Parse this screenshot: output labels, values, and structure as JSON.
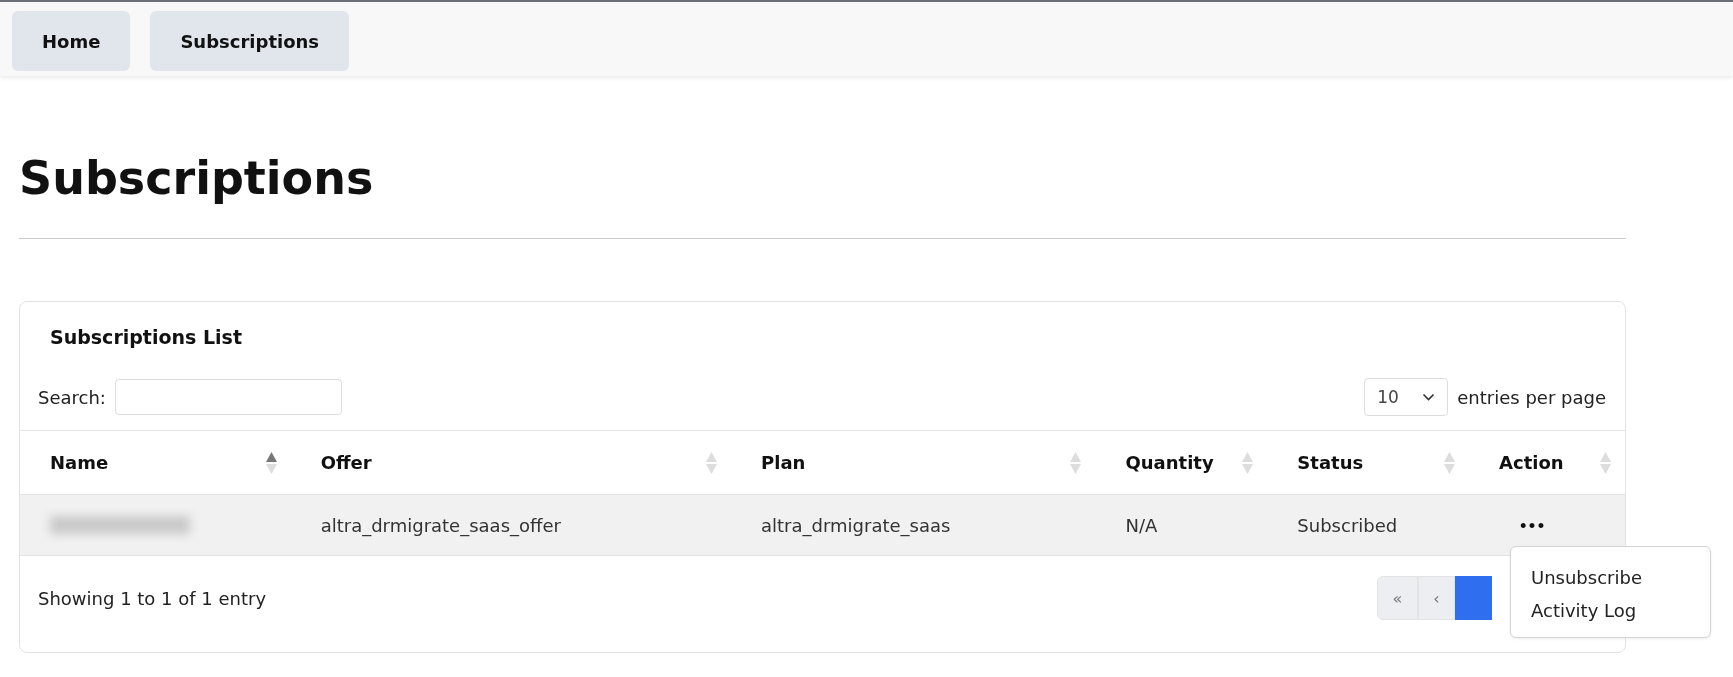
{
  "nav": [
    {
      "label": "Home"
    },
    {
      "label": "Subscriptions"
    }
  ],
  "page_title": "Subscriptions",
  "card": {
    "title": "Subscriptions List",
    "search": {
      "label": "Search:"
    },
    "page_size": {
      "value": "10",
      "suffix": "entries per page"
    },
    "table": {
      "columns": [
        {
          "label": "Name",
          "sorted": true
        },
        {
          "label": "Offer",
          "sorted": false
        },
        {
          "label": "Plan",
          "sorted": false
        },
        {
          "label": "Quantity",
          "sorted": false
        },
        {
          "label": "Status",
          "sorted": false
        },
        {
          "label": "Action",
          "sorted": false
        }
      ],
      "rows": [
        {
          "name": {
            "kind": "blurred"
          },
          "offer": "altra_drmigrate_saas_offer",
          "plan": "altra_drmigrate_saas",
          "quantity": "N/A",
          "status": "Subscribed",
          "action": "•••"
        }
      ]
    },
    "summary": "Showing 1 to 1 of 1 entry",
    "pagination": [
      {
        "label": "«",
        "selected": false
      },
      {
        "label": "‹",
        "selected": false
      },
      {
        "selected": true
      }
    ]
  },
  "action_menu": {
    "items": [
      "Unsubscribe",
      "Activity Log"
    ]
  }
}
